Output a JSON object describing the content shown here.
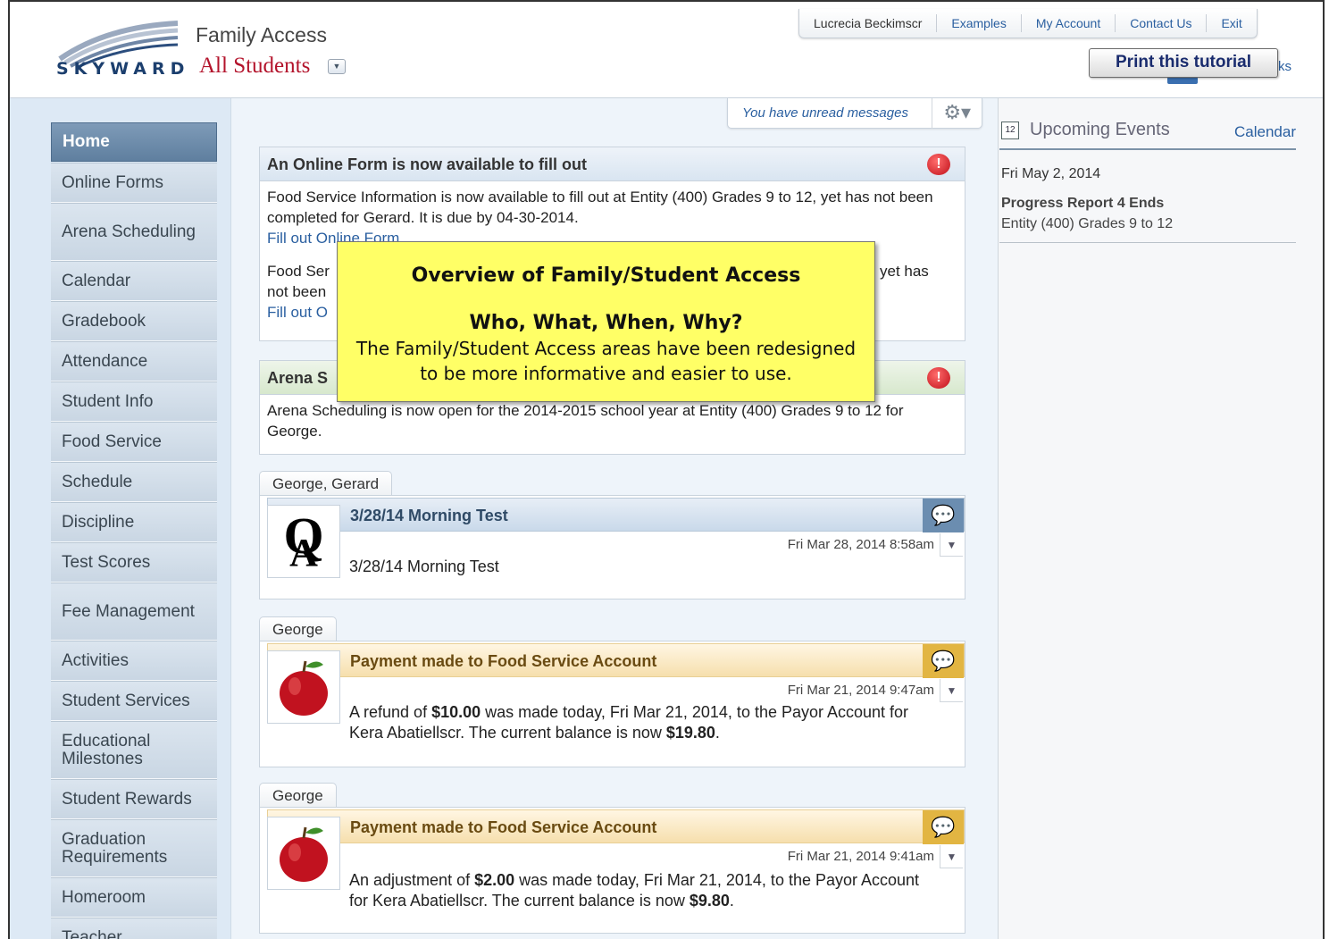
{
  "header": {
    "logo_text": "SKYWARD",
    "app_title": "Family Access",
    "student_selector": "All Students",
    "nav": [
      "Lucrecia Beckimscr",
      "Examples",
      "My Account",
      "Contact Us",
      "Exit"
    ],
    "print_button": "Print this tutorial",
    "partial_link": "ks"
  },
  "sidebar": {
    "items": [
      {
        "label": "Home",
        "active": true
      },
      {
        "label": "Online Forms"
      },
      {
        "label": "Arena Scheduling"
      },
      {
        "label": "Calendar"
      },
      {
        "label": "Gradebook"
      },
      {
        "label": "Attendance"
      },
      {
        "label": "Student Info"
      },
      {
        "label": "Food Service"
      },
      {
        "label": "Schedule"
      },
      {
        "label": "Discipline"
      },
      {
        "label": "Test Scores"
      },
      {
        "label": "Fee Management"
      },
      {
        "label": "Activities"
      },
      {
        "label": "Student Services"
      },
      {
        "label": "Educational Milestones"
      },
      {
        "label": "Student Rewards"
      },
      {
        "label": "Graduation Requirements"
      },
      {
        "label": "Homeroom"
      },
      {
        "label": "Teacher"
      }
    ]
  },
  "messages": {
    "unread": "You have unread messages"
  },
  "cards": {
    "online_form": {
      "title": "An Online Form is now available to fill out",
      "p1": "Food Service Information is now available to fill out at Entity (400) Grades 9 to 12, yet has not been completed for Gerard.  It is due by 04-30-2014.",
      "link1": "Fill out Online Form",
      "p2_left": "Food Ser",
      "p2_right": "yet has",
      "p2_line2": "not been",
      "link2": "Fill out O"
    },
    "arena": {
      "title": "Arena S",
      "body": "Arena Scheduling is now open for the 2014-2015 school year at Entity (400) Grades 9 to 12 for George."
    }
  },
  "callout": {
    "title": "Overview of Family/Student Access",
    "subtitle": "Who, What, When, Why?",
    "body_line1": "The Family/Student Access areas have been redesigned",
    "body_line2": "to be more informative and easier to use."
  },
  "feed": [
    {
      "tab": "George, Gerard",
      "title": "3/28/14 Morning Test",
      "time": "Fri Mar 28, 2014 8:58am",
      "text": "3/28/14 Morning Test"
    },
    {
      "tab": "George",
      "title": "Payment made to Food Service Account",
      "time": "Fri Mar 21, 2014 9:47am",
      "text_a": "A refund of ",
      "amount1": "$10.00",
      "text_b": " was made today, Fri Mar 21, 2014, to the Payor Account for Kera Abatiellscr. The current balance is now ",
      "amount2": "$19.80",
      "text_c": "."
    },
    {
      "tab": "George",
      "title": "Payment made to Food Service Account",
      "time": "Fri Mar 21, 2014 9:41am",
      "text_a": "An adjustment of ",
      "amount1": "$2.00",
      "text_b": " was made today, Fri Mar 21, 2014, to the Payor Account for Kera Abatiellscr. The current balance is now ",
      "amount2": "$9.80",
      "text_c": "."
    }
  ],
  "events": {
    "title": "Upcoming Events",
    "calendar_link": "Calendar",
    "icon_text": "12",
    "date": "Fri May 2, 2014",
    "name": "Progress Report 4 Ends",
    "location": "Entity (400) Grades 9 to 12"
  }
}
